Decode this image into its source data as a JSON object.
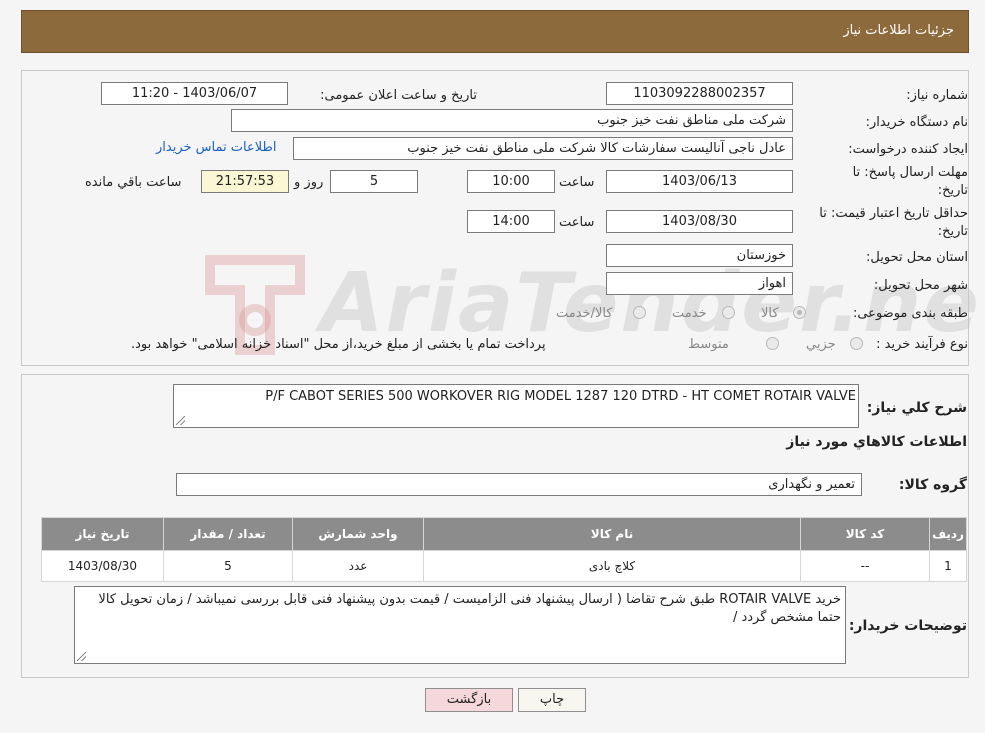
{
  "header": {
    "title": "جزئیات اطلاعات نیاز"
  },
  "form": {
    "need_number": {
      "label": "شماره نیاز:",
      "value": "1103092288002357"
    },
    "announce_datetime": {
      "label": "تاریخ و ساعت اعلان عمومی:",
      "value": "1403/06/07 - 11:20"
    },
    "buyer_org": {
      "label": "نام دستگاه خریدار:",
      "value": "شرکت ملی مناطق نفت خیز جنوب"
    },
    "requester": {
      "label": "ایجاد کننده درخواست:",
      "value": "عادل  ناجی آنالیست سفارشات کالا  شرکت ملی مناطق نفت خیز جنوب"
    },
    "contact_link": "اطلاعات تماس خریدار",
    "reply_deadline": {
      "label_line1": "مهلت ارسال پاسخ: تا",
      "label_line2": "تاریخ:",
      "date": "1403/06/13",
      "time_label": "ساعت",
      "time": "10:00",
      "days": "5",
      "days_label": "روز و",
      "remaining": "21:57:53",
      "remaining_label": "ساعت باقي مانده"
    },
    "price_validity": {
      "label_line1": "حداقل تاریخ اعتبار قیمت: تا",
      "label_line2": "تاریخ:",
      "date": "1403/08/30",
      "time_label": "ساعت",
      "time": "14:00"
    },
    "province": {
      "label": "استان محل تحویل:",
      "value": "خوزستان"
    },
    "city": {
      "label": "شهر محل تحویل:",
      "value": "اهواز"
    },
    "category": {
      "label": "طبقه بندی موضوعی:",
      "options": [
        "کالا",
        "خدمت",
        "کالا/خدمت"
      ]
    },
    "purchase_type": {
      "label": "نوع فرآیند خرید :",
      "options": [
        "جزیي",
        "متوسط"
      ],
      "note": "پرداخت تمام یا بخشی از مبلغ خرید،از محل \"اسناد خزانه اسلامی\" خواهد بود."
    }
  },
  "summary": {
    "label": "شرح كلي نياز:",
    "value": "P/F  CABOT  SERIES 500 WORKOVER RIG  MODEL 1287  120 DTRD - HT  COMET  ROTAIR VALVE"
  },
  "goods_section_title": "اطلاعات كالاهاي مورد نياز",
  "goods_group": {
    "label": "گروه کالا:",
    "value": "تعمیر و نگهداری"
  },
  "items_table": {
    "headers": [
      "ردیف",
      "کد کالا",
      "نام کالا",
      "واحد شمارش",
      "تعداد / مقدار",
      "تاریخ نیاز"
    ],
    "rows": [
      [
        "1",
        "--",
        "کلاچ بادی",
        "عدد",
        "5",
        "1403/08/30"
      ]
    ]
  },
  "buyer_notes": {
    "label": "توضیحات خریدار:",
    "value": "خرید ROTAIR VALVE  طبق شرح تقاضا ( ارسال پیشنهاد فنی الزامیست / قیمت بدون پیشنهاد فنی قابل بررسی نمیباشد / زمان تحویل کالا حتما مشخص گردد /"
  },
  "buttons": {
    "print": "چاپ",
    "back": "بازگشت"
  },
  "watermark": {
    "text": "AriaTender.neT",
    "color": "#c8c8c8"
  }
}
